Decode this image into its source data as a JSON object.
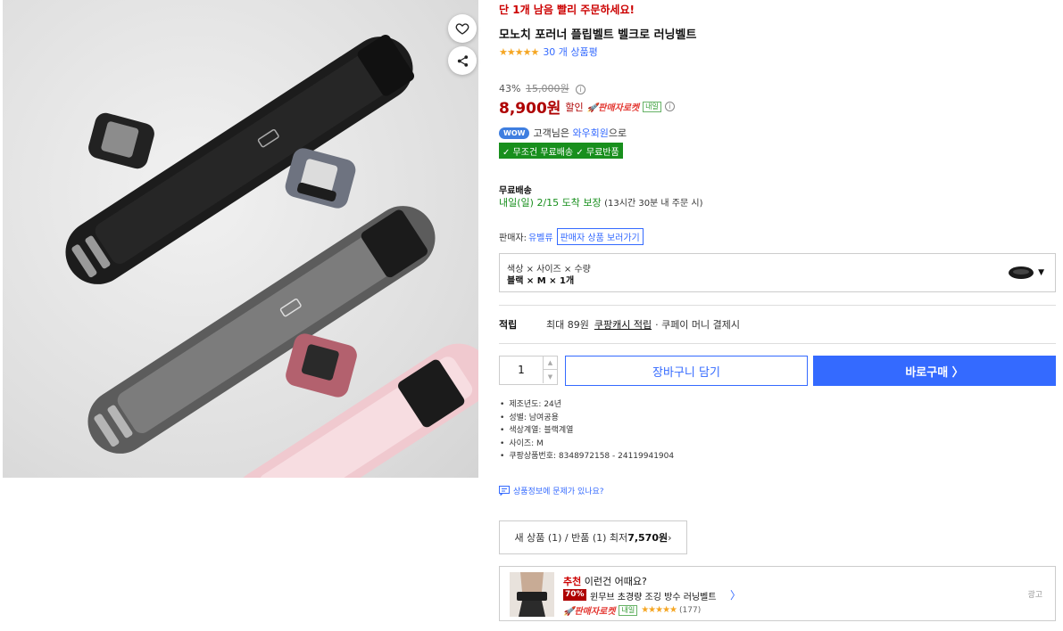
{
  "urgency": "단 1개 남음 빨리 주문하세요!",
  "product": {
    "title": "모노치 포러너 플립벨트 벨크로 러닝벨트",
    "rating_stars": "★★★★★",
    "rating_value": 4.5,
    "review_text": "30 개 상품평"
  },
  "pricing": {
    "discount_pct": "43%",
    "original_price": "15,000원",
    "sale_price": "8,900원",
    "sale_label": "할인",
    "seller_rocket": "판매자로켓",
    "tomorrow_badge": "내일"
  },
  "wow": {
    "badge": "WOW",
    "text_prefix": "고객님은 ",
    "member": "와우회원",
    "text_suffix": "으로",
    "free_badge": "✓ 무조건 무료배송 ✓ 무료반품"
  },
  "shipping": {
    "title": "무료배송",
    "eta": "내일(일) 2/15 도착 보장",
    "condition": "(13시간 30분 내 주문 시)"
  },
  "seller": {
    "label": "판매자:",
    "name": "유벨류",
    "link": "판매자 상품 보러가기"
  },
  "option": {
    "label": "색상 × 사이즈 × 수량",
    "value": "블랙 × M × 1개"
  },
  "reward": {
    "label": "적립",
    "max": "최대 89원",
    "cash": "쿠팡캐시 적립",
    "suffix": "· 쿠페이 머니 결제시"
  },
  "purchase": {
    "quantity": "1",
    "cart_label": "장바구니 담기",
    "buy_label": "바로구매 〉"
  },
  "specs": [
    "제조년도: 24년",
    "성별: 남여공용",
    "색상계열: 블랙계열",
    "사이즈: M",
    "쿠팡상품번호: 8348972158 - 24119941904"
  ],
  "report_link": "상품정보에 문제가 있나요?",
  "offers": {
    "prefix": "새 상품 (1) / 반품 (1) 최저 ",
    "price": "7,570원",
    "suffix": " ›"
  },
  "ad": {
    "headline_highlight": "추천",
    "headline_rest": " 이런건 어때요?",
    "discount": "70%",
    "name": "윈무브 초경량 조깅 방수 러닝벨트",
    "chevron": "〉",
    "seller_rocket": "판매자로켓",
    "tomorrow_badge": "내일",
    "stars": "★★★★★",
    "count": "(177)",
    "label": "광고"
  },
  "colors": {
    "accent": "#346aff",
    "price_red": "#ae0000",
    "free_green": "#188f1d",
    "star": "#f5a623"
  }
}
